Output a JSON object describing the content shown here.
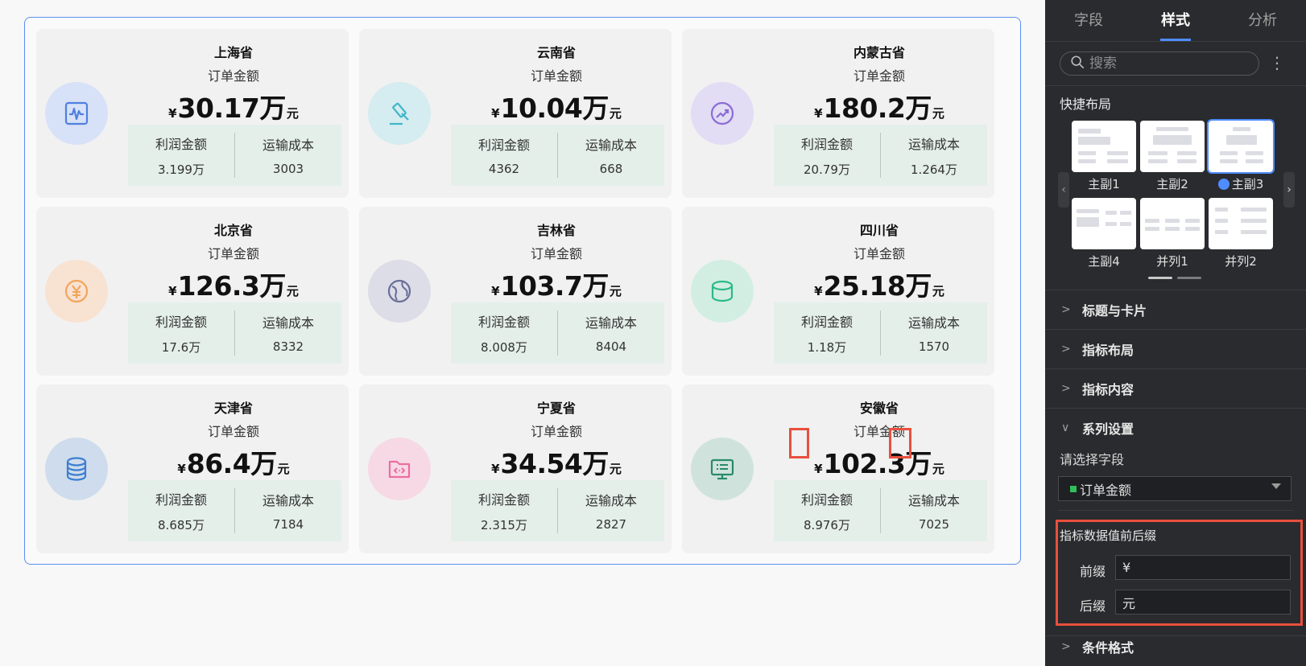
{
  "cards": [
    {
      "title": "上海省",
      "metric_label": "订单金额",
      "prefix": "¥",
      "value": "30.17万",
      "suffix": "元",
      "sub1_label": "利润金额",
      "sub1_value": "3.199万",
      "sub2_label": "运输成本",
      "sub2_value": "3003",
      "icon": "heartbeat-chart-icon",
      "icon_color": "#4f7fe0",
      "icon_bg": "#d7e1f7"
    },
    {
      "title": "云南省",
      "metric_label": "订单金额",
      "prefix": "¥",
      "value": "10.04万",
      "suffix": "元",
      "sub1_label": "利润金额",
      "sub1_value": "4362",
      "sub2_label": "运输成本",
      "sub2_value": "668",
      "icon": "gavel-icon",
      "icon_color": "#3fb6c7",
      "icon_bg": "#d5ecf0"
    },
    {
      "title": "内蒙古省",
      "metric_label": "订单金额",
      "prefix": "¥",
      "value": "180.2万",
      "suffix": "元",
      "sub1_label": "利润金额",
      "sub1_value": "20.79万",
      "sub2_label": "运输成本",
      "sub2_value": "1.264万",
      "icon": "trend-up-icon",
      "icon_color": "#8a6cd6",
      "icon_bg": "#e2dcf4"
    },
    {
      "title": "北京省",
      "metric_label": "订单金额",
      "prefix": "¥",
      "value": "126.3万",
      "suffix": "元",
      "sub1_label": "利润金额",
      "sub1_value": "17.6万",
      "sub2_label": "运输成本",
      "sub2_value": "8332",
      "icon": "yen-coin-icon",
      "icon_color": "#f2a55c",
      "icon_bg": "#f8e2d2"
    },
    {
      "title": "吉林省",
      "metric_label": "订单金额",
      "prefix": "¥",
      "value": "103.7万",
      "suffix": "元",
      "sub1_label": "利润金额",
      "sub1_value": "8.008万",
      "sub2_label": "运输成本",
      "sub2_value": "8404",
      "icon": "globe-icon",
      "icon_color": "#6a6f9a",
      "icon_bg": "#dcdde6"
    },
    {
      "title": "四川省",
      "metric_label": "订单金额",
      "prefix": "¥",
      "value": "25.18万",
      "suffix": "元",
      "sub1_label": "利润金额",
      "sub1_value": "1.18万",
      "sub2_label": "运输成本",
      "sub2_value": "1570",
      "icon": "cylinder-icon",
      "icon_color": "#2cb98a",
      "icon_bg": "#d2eee3"
    },
    {
      "title": "天津省",
      "metric_label": "订单金额",
      "prefix": "¥",
      "value": "86.4万",
      "suffix": "元",
      "sub1_label": "利润金额",
      "sub1_value": "8.685万",
      "sub2_label": "运输成本",
      "sub2_value": "7184",
      "icon": "database-icon",
      "icon_color": "#3d7fd0",
      "icon_bg": "#cfdced"
    },
    {
      "title": "宁夏省",
      "metric_label": "订单金额",
      "prefix": "¥",
      "value": "34.54万",
      "suffix": "元",
      "sub1_label": "利润金额",
      "sub1_value": "2.315万",
      "sub2_label": "运输成本",
      "sub2_value": "2827",
      "icon": "code-folder-icon",
      "icon_color": "#ea6f9e",
      "icon_bg": "#f7d9e5"
    },
    {
      "title": "安徽省",
      "metric_label": "订单金额",
      "prefix": "¥",
      "value": "102.3万",
      "suffix": "元",
      "sub1_label": "利润金额",
      "sub1_value": "8.976万",
      "sub2_label": "运输成本",
      "sub2_value": "7025",
      "icon": "monitor-icon",
      "icon_color": "#2a8a6a",
      "icon_bg": "#cfe3dc"
    }
  ],
  "panel": {
    "tabs": [
      "字段",
      "样式",
      "分析"
    ],
    "active_tab": "样式",
    "search_placeholder": "搜索",
    "more_icon": "more-vertical-icon",
    "quick_layout_title": "快捷布局",
    "layouts": [
      "主副1",
      "主副2",
      "主副3",
      "主副4",
      "并列1",
      "并列2"
    ],
    "selected_layout": "主副3",
    "sections": [
      "标题与卡片",
      "指标布局",
      "指标内容",
      "系列设置",
      "条件格式"
    ],
    "field_select_label": "请选择字段",
    "field_selected": "订单金额",
    "affix_title": "指标数据值前后缀",
    "prefix_label": "前缀",
    "prefix_value": "¥",
    "suffix_label": "后缀",
    "suffix_value": "元"
  },
  "colors": {
    "accent": "#4f8cff",
    "highlight": "#e8503d",
    "panel_bg": "#2a2b2e",
    "board_border": "#5b8ff0",
    "sub_panel_bg": "#e4efea"
  }
}
